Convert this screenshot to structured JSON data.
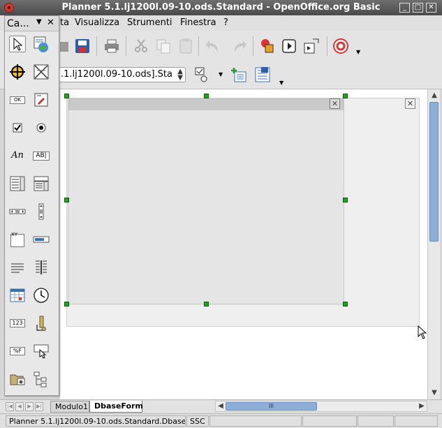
{
  "window": {
    "title": "Planner 5.1.lj1200l.09-10.ods.Standard - OpenOffice.org Basic",
    "buttons": [
      "minimize",
      "maximize",
      "close"
    ]
  },
  "menu": {
    "partial_first": "ta",
    "items": [
      "Visualizza",
      "Strumenti",
      "Finestra",
      "?"
    ]
  },
  "toolbar2": {
    "library_combo": ".1.lj1200l.09-10.ods].Sta"
  },
  "palette": {
    "title": "Ca...",
    "tools": [
      "select-icon",
      "image-control-icon",
      "crosshair-icon",
      "activate-test-mode-icon",
      "ok-button-icon",
      "properties-icon",
      "checkbox-icon",
      "option-button-icon",
      "label-icon",
      "text-box-icon",
      "list-box-icon",
      "combo-box-icon",
      "horizontal-scrollbar-icon",
      "vertical-scrollbar-icon",
      "group-box-icon",
      "progress-bar-icon",
      "horizontal-line-icon",
      "vertical-line-icon",
      "date-field-icon",
      "time-field-icon",
      "numeric-field-icon",
      "currency-field-icon",
      "formatted-field-icon",
      "pattern-field-icon",
      "file-selection-icon",
      "tree-control-icon"
    ],
    "labels": {
      "ok": "OK",
      "label_text": "An",
      "textbox_text": "AB|",
      "xy": "XY",
      "num": "123",
      "fmt": "%F"
    }
  },
  "tabs": {
    "items": [
      "Modulo1",
      "DbaseForm"
    ],
    "active": "DbaseForm"
  },
  "hscroll": {
    "thumb_label": "III"
  },
  "status": {
    "path": "Planner 5.1.lj1200l.09-10.ods.Standard.DbaseForm",
    "mode": "SSC"
  }
}
